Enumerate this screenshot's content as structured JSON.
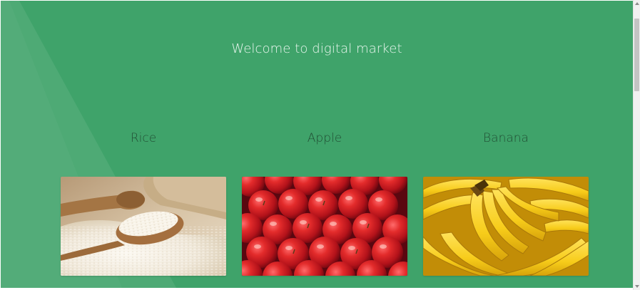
{
  "hero": {
    "title": "Welcome to digital market"
  },
  "products": [
    {
      "label": "Rice",
      "image_icon": "rice-image"
    },
    {
      "label": "Apple",
      "image_icon": "apple-image"
    },
    {
      "label": "Banana",
      "image_icon": "banana-image"
    }
  ],
  "colors": {
    "background": "#3fa36a",
    "title_text": "#e9f6ee",
    "label_text": "#1c3f2a"
  }
}
